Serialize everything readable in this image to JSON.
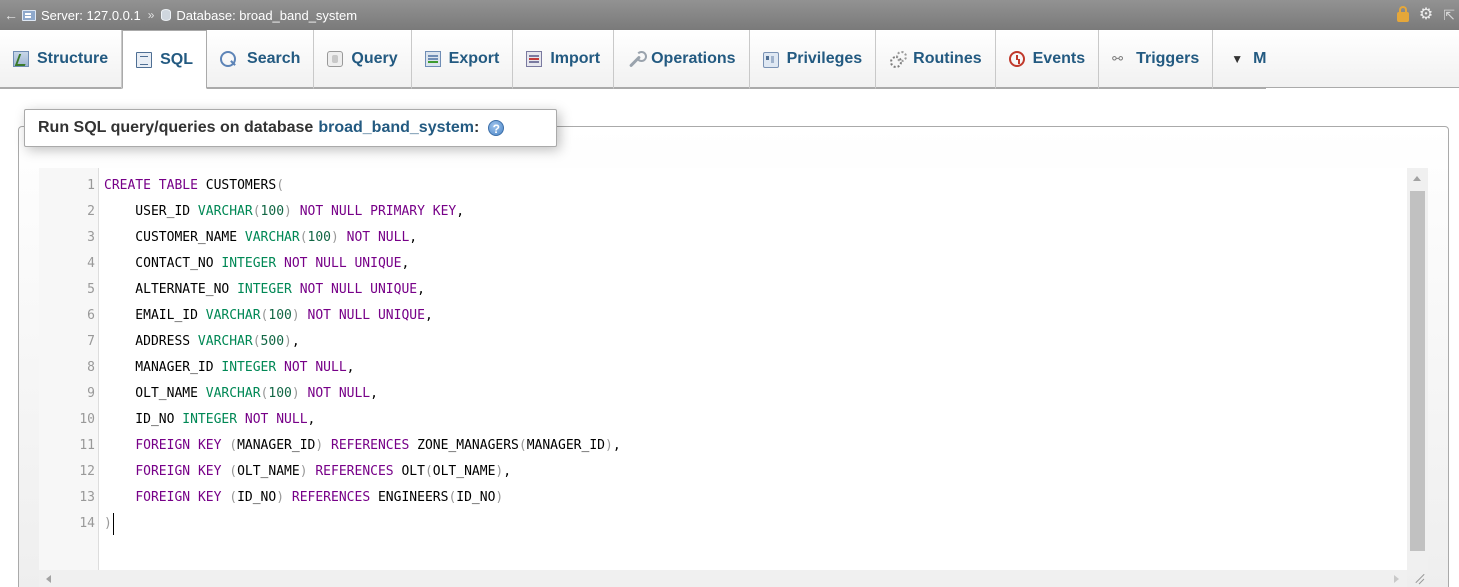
{
  "breadcrumb": {
    "back_glyph": "←",
    "server_label": "Server: 127.0.0.1",
    "separator": "»",
    "database_label": "Database: broad_band_system"
  },
  "topbar_icons": [
    "lock-icon",
    "gear-icon",
    "collapse-icon"
  ],
  "tabs": [
    {
      "label": "Structure",
      "icon": "structure-icon",
      "active": false
    },
    {
      "label": "SQL",
      "icon": "sql-icon",
      "active": true
    },
    {
      "label": "Search",
      "icon": "search-icon",
      "active": false
    },
    {
      "label": "Query",
      "icon": "query-icon",
      "active": false
    },
    {
      "label": "Export",
      "icon": "export-icon",
      "active": false
    },
    {
      "label": "Import",
      "icon": "import-icon",
      "active": false
    },
    {
      "label": "Operations",
      "icon": "operations-icon",
      "active": false
    },
    {
      "label": "Privileges",
      "icon": "privileges-icon",
      "active": false
    },
    {
      "label": "Routines",
      "icon": "routines-icon",
      "active": false
    },
    {
      "label": "Events",
      "icon": "events-icon",
      "active": false
    },
    {
      "label": "Triggers",
      "icon": "triggers-icon",
      "active": false
    },
    {
      "label": "M",
      "icon": "caret-down-icon",
      "active": false
    }
  ],
  "sql_panel": {
    "heading": "Run SQL query/queries on database",
    "database_name": "broad_band_system",
    "colon": ":",
    "help_glyph": "?"
  },
  "editor": {
    "line_numbers": [
      "1",
      "2",
      "3",
      "4",
      "5",
      "6",
      "7",
      "8",
      "9",
      "10",
      "11",
      "12",
      "13",
      "14"
    ],
    "lines": [
      "CREATE TABLE CUSTOMERS(",
      "    USER_ID VARCHAR(100) NOT NULL PRIMARY KEY,",
      "    CUSTOMER_NAME VARCHAR(100) NOT NULL,",
      "    CONTACT_NO INTEGER NOT NULL UNIQUE,",
      "    ALTERNATE_NO INTEGER NOT NULL UNIQUE,",
      "    EMAIL_ID VARCHAR(100) NOT NULL UNIQUE,",
      "    ADDRESS VARCHAR(500),",
      "    MANAGER_ID INTEGER NOT NULL,",
      "    OLT_NAME VARCHAR(100) NOT NULL,",
      "    ID_NO INTEGER NOT NULL,",
      "    FOREIGN KEY (MANAGER_ID) REFERENCES ZONE_MANAGERS(MANAGER_ID),",
      "    FOREIGN KEY (OLT_NAME) REFERENCES OLT(OLT_NAME),",
      "    FOREIGN KEY (ID_NO) REFERENCES ENGINEERS(ID_NO)",
      ")"
    ]
  },
  "colors": {
    "keyword": "#770088",
    "type": "#008855",
    "number": "#116644",
    "link": "#235a81",
    "topbar": "#888888"
  }
}
